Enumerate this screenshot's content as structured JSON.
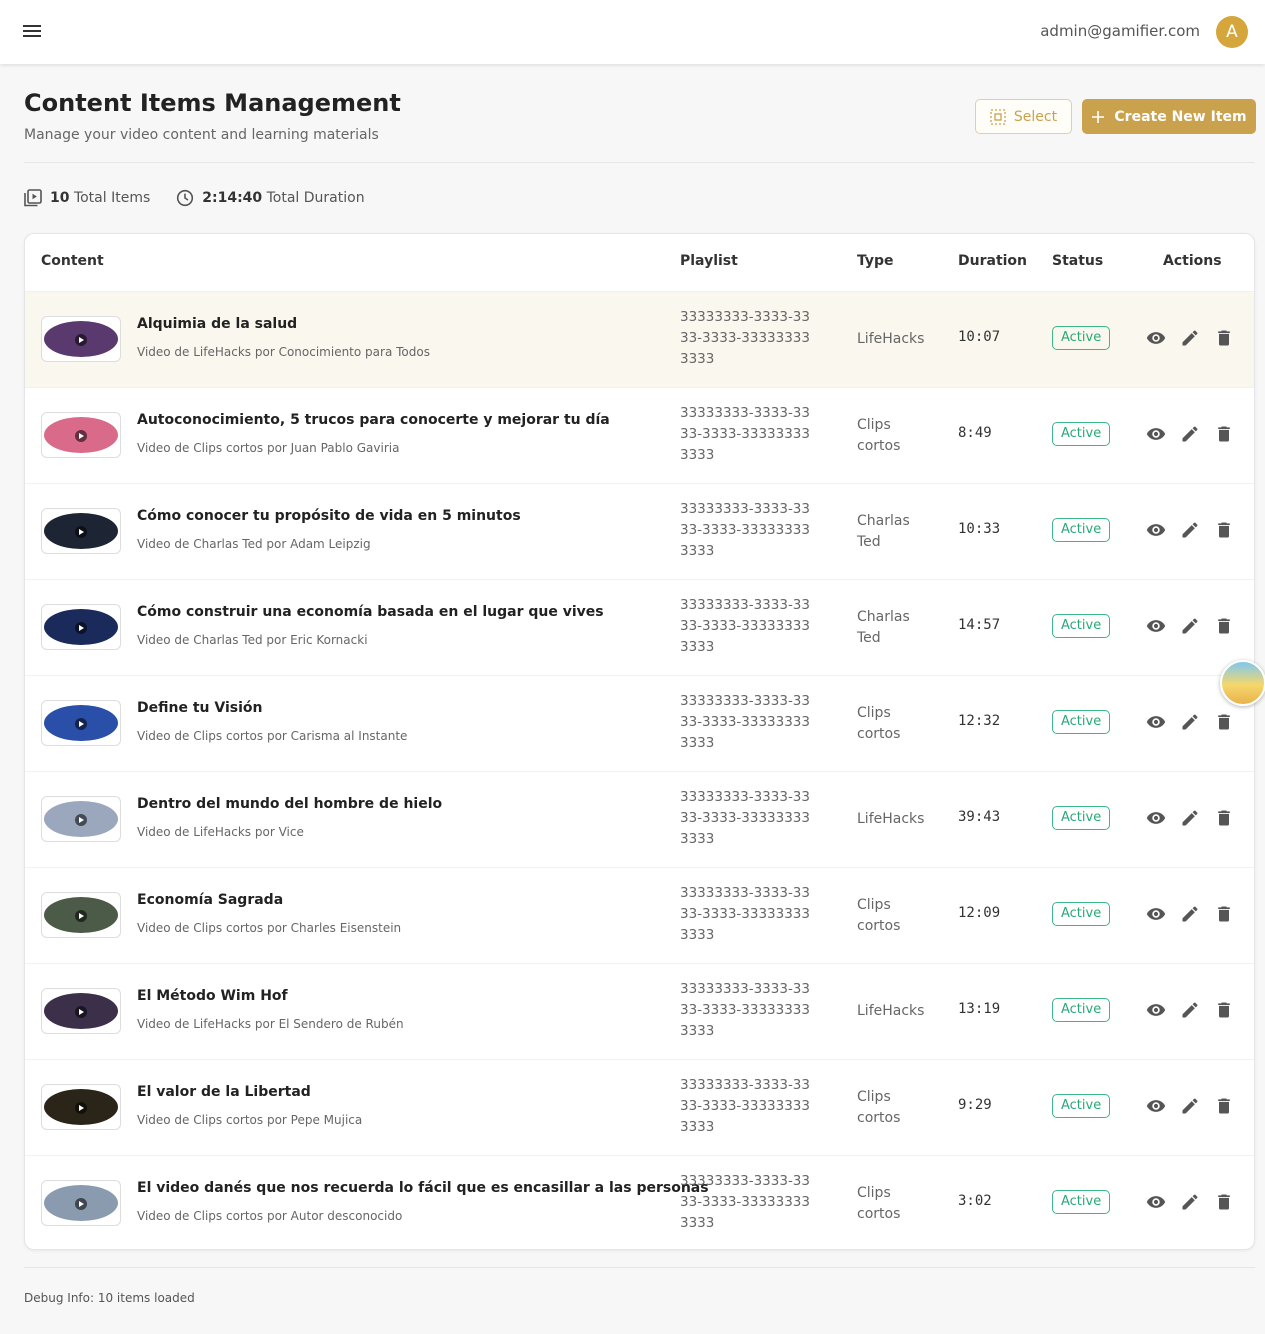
{
  "header": {
    "user_email": "admin@gamifier.com",
    "avatar_initial": "A"
  },
  "page": {
    "title": "Content Items Management",
    "subtitle": "Manage your video content and learning materials",
    "select_label": "Select",
    "create_label": "Create New Item"
  },
  "stats": {
    "total_items_value": "10",
    "total_items_label": "Total Items",
    "total_duration_value": "2:14:40",
    "total_duration_label": "Total Duration"
  },
  "table": {
    "columns": [
      "Content",
      "Playlist",
      "Type",
      "Duration",
      "Status",
      "Actions"
    ],
    "rows": [
      {
        "title": "Alquimia de la salud",
        "subtitle": "Video de LifeHacks por Conocimiento para Todos",
        "playlist": "33333333-3333-3333-3333-333333333333",
        "type": "LifeHacks",
        "duration": "10:07",
        "status": "Active"
      },
      {
        "title": "Autoconocimiento, 5 trucos para conocerte y mejorar tu día",
        "subtitle": "Video de Clips cortos por Juan Pablo Gaviria",
        "playlist": "33333333-3333-3333-3333-333333333333",
        "type": "Clips cortos",
        "duration": "8:49",
        "status": "Active"
      },
      {
        "title": "Cómo conocer tu propósito de vida en 5 minutos",
        "subtitle": "Video de Charlas Ted por Adam Leipzig",
        "playlist": "33333333-3333-3333-3333-333333333333",
        "type": "Charlas Ted",
        "duration": "10:33",
        "status": "Active"
      },
      {
        "title": "Cómo construir una economía basada en el lugar que vives",
        "subtitle": "Video de Charlas Ted por Eric Kornacki",
        "playlist": "33333333-3333-3333-3333-333333333333",
        "type": "Charlas Ted",
        "duration": "14:57",
        "status": "Active"
      },
      {
        "title": "Define tu Visión",
        "subtitle": "Video de Clips cortos por Carisma al Instante",
        "playlist": "33333333-3333-3333-3333-333333333333",
        "type": "Clips cortos",
        "duration": "12:32",
        "status": "Active"
      },
      {
        "title": "Dentro del mundo del hombre de hielo",
        "subtitle": "Video de LifeHacks por Vice",
        "playlist": "33333333-3333-3333-3333-333333333333",
        "type": "LifeHacks",
        "duration": "39:43",
        "status": "Active"
      },
      {
        "title": "Economía Sagrada",
        "subtitle": "Video de Clips cortos por Charles Eisenstein",
        "playlist": "33333333-3333-3333-3333-333333333333",
        "type": "Clips cortos",
        "duration": "12:09",
        "status": "Active"
      },
      {
        "title": "El Método Wim Hof",
        "subtitle": "Video de LifeHacks por El Sendero de Rubén",
        "playlist": "33333333-3333-3333-3333-333333333333",
        "type": "LifeHacks",
        "duration": "13:19",
        "status": "Active"
      },
      {
        "title": "El valor de la Libertad",
        "subtitle": "Video de Clips cortos por Pepe Mujica",
        "playlist": "33333333-3333-3333-3333-333333333333",
        "type": "Clips cortos",
        "duration": "9:29",
        "status": "Active"
      },
      {
        "title": "El video danés que nos recuerda lo fácil que es encasillar a las personas",
        "subtitle": "Video de Clips cortos por Autor desconocido",
        "playlist": "33333333-3333-3333-3333-333333333333",
        "type": "Clips cortos",
        "duration": "3:02",
        "status": "Active"
      }
    ]
  },
  "thumb_colors": [
    "#5a3a6e",
    "#d96a8a",
    "#1d2433",
    "#1a2a5a",
    "#2a4fa8",
    "#9aa7bd",
    "#4c5a48",
    "#3c2f4a",
    "#2b2418",
    "#8a9bb0"
  ],
  "debug": "Debug Info: 10 items loaded",
  "colors": {
    "accent": "#caa24e",
    "active": "#2aa978",
    "highlight_row": "#faf7ee"
  }
}
